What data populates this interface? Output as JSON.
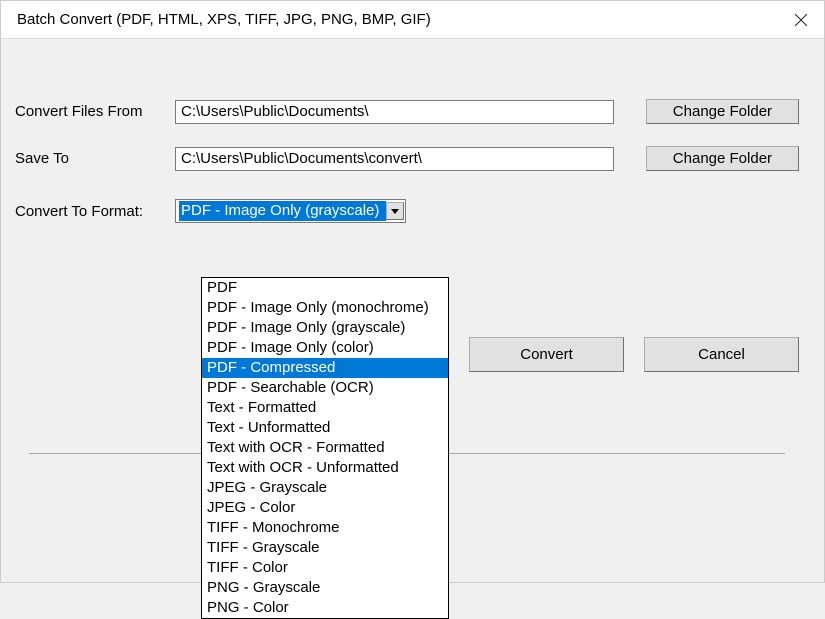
{
  "titlebar": {
    "title": "Batch Convert (PDF, HTML, XPS, TIFF, JPG, PNG, BMP, GIF)"
  },
  "labels": {
    "from": "Convert Files From",
    "saveTo": "Save To",
    "format": "Convert To Format:"
  },
  "paths": {
    "from": "C:\\Users\\Public\\Documents\\",
    "saveTo": "C:\\Users\\Public\\Documents\\convert\\"
  },
  "buttons": {
    "changeFolder": "Change Folder",
    "convert": "Convert",
    "cancel": "Cancel"
  },
  "format": {
    "selected": "PDF - Image Only (grayscale)",
    "highlighted": "PDF - Compressed",
    "options": [
      "PDF",
      "PDF - Image Only (monochrome)",
      "PDF - Image Only (grayscale)",
      "PDF - Image Only (color)",
      "PDF - Compressed",
      "PDF - Searchable (OCR)",
      "Text - Formatted",
      "Text - Unformatted",
      "Text with OCR - Formatted",
      "Text with OCR - Unformatted",
      "JPEG - Grayscale",
      "JPEG - Color",
      "TIFF - Monochrome",
      "TIFF - Grayscale",
      "TIFF - Color",
      "PNG - Grayscale",
      "PNG - Color"
    ]
  }
}
